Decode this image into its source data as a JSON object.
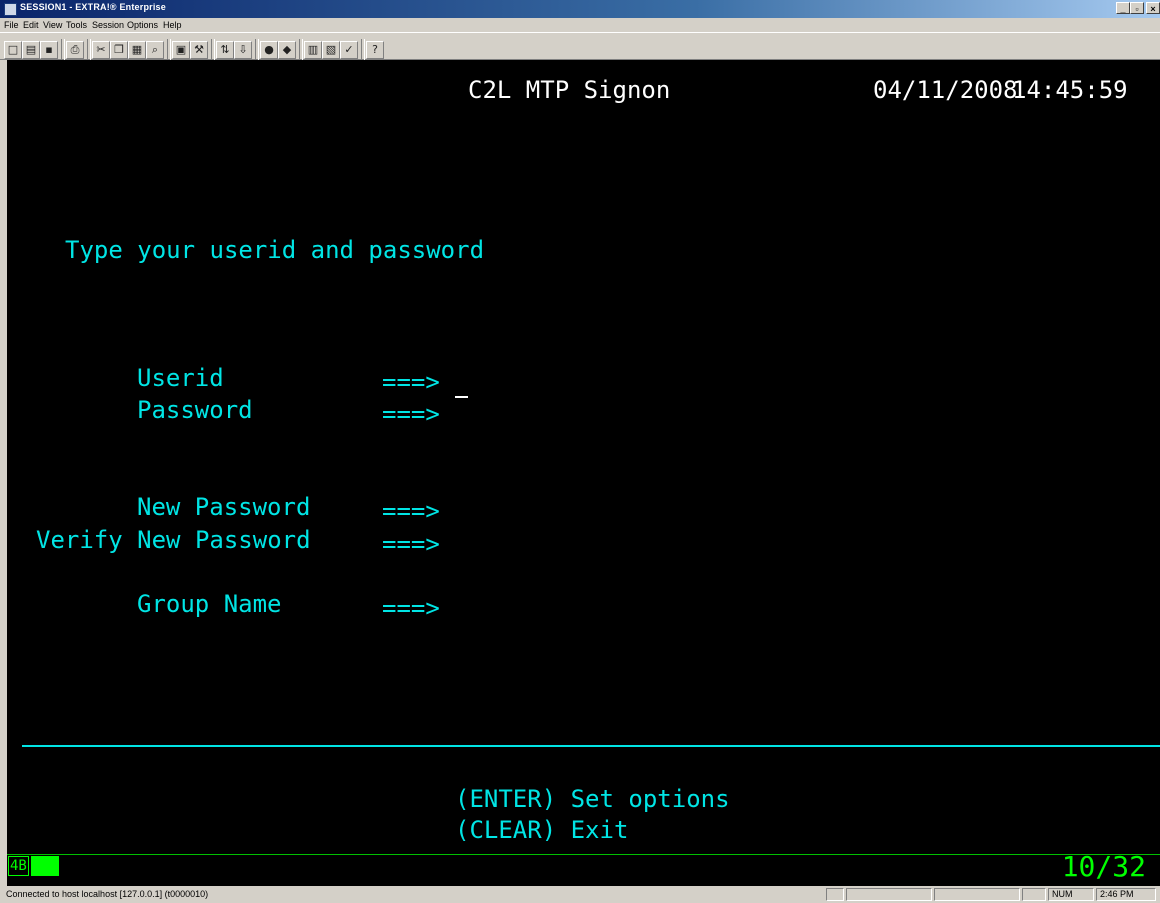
{
  "window": {
    "title": "SESSION1 - EXTRA!® Enterprise"
  },
  "menu": [
    "File",
    "Edit",
    "View",
    "Tools",
    "Session",
    "Options",
    "Help"
  ],
  "screen": {
    "header_title": "C2L MTP Signon",
    "date": "04/11/2008",
    "time": "14:45:59",
    "instruction": "Type your userid and password",
    "fields": [
      {
        "label": "Userid",
        "arrow": "===>"
      },
      {
        "label": "Password",
        "arrow": "===>"
      },
      {
        "label": "New Password",
        "arrow": "===>"
      },
      {
        "label": "Verify New Password",
        "arrow": "===>"
      },
      {
        "label": "Group Name",
        "arrow": "===>"
      }
    ],
    "keys": [
      "(ENTER) Set options",
      "(CLEAR) Exit"
    ]
  },
  "oia": {
    "session_indicator": "4B",
    "cursor_position": "10/32"
  },
  "statusbar": {
    "message": "Connected to host localhost [127.0.0.1] (t0000010)",
    "num": "NUM",
    "clock": "2:46 PM"
  },
  "colors": {
    "terminal_bg": "#000000",
    "field_text": "#00e5e5",
    "title_text": "#ffffff",
    "oia_green": "#00ff00"
  }
}
